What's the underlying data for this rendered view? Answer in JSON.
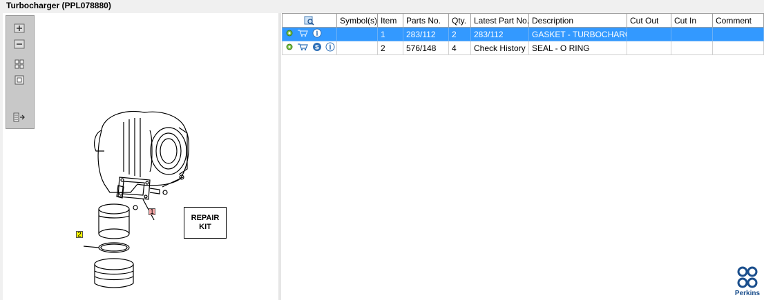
{
  "window": {
    "title": "Turbocharger (PPL078880)"
  },
  "toolbar": {
    "icons": [
      "zoom-in-icon",
      "zoom-out-icon",
      "fit-all-icon",
      "actual-size-icon",
      "export-icon"
    ]
  },
  "drawing": {
    "callouts": [
      {
        "label": "1",
        "color": "#f4a6a6"
      },
      {
        "label": "2",
        "color": "#ffff00"
      }
    ],
    "repair_kit_label": "REPAIR\nKIT"
  },
  "table": {
    "columns": [
      "",
      "Symbol(s)",
      "Item",
      "Parts No.",
      "Qty.",
      "Latest Part No.",
      "Description",
      "Cut Out",
      "Cut In",
      "Comment"
    ],
    "rows": [
      {
        "selected": true,
        "icons": [
          "gear-icon",
          "cart-icon",
          "info-icon"
        ],
        "symbols": "",
        "item": "1",
        "parts_no": "283/112",
        "qty": "2",
        "latest_part_no": "283/112",
        "description": "GASKET - TURBOCHARGER",
        "cut_out": "",
        "cut_in": "",
        "comment": ""
      },
      {
        "selected": false,
        "icons": [
          "gear-icon",
          "cart-icon",
          "service-icon",
          "info-icon"
        ],
        "symbols": "",
        "item": "2",
        "parts_no": "576/148",
        "qty": "4",
        "latest_part_no": "Check History",
        "description": "SEAL - O RING",
        "cut_out": "",
        "cut_in": "",
        "comment": ""
      }
    ]
  },
  "logo": {
    "text": "Perkins",
    "color": "#1a4e8c"
  },
  "colors": {
    "selection": "#3399ff",
    "background": "#f0f0f0"
  }
}
